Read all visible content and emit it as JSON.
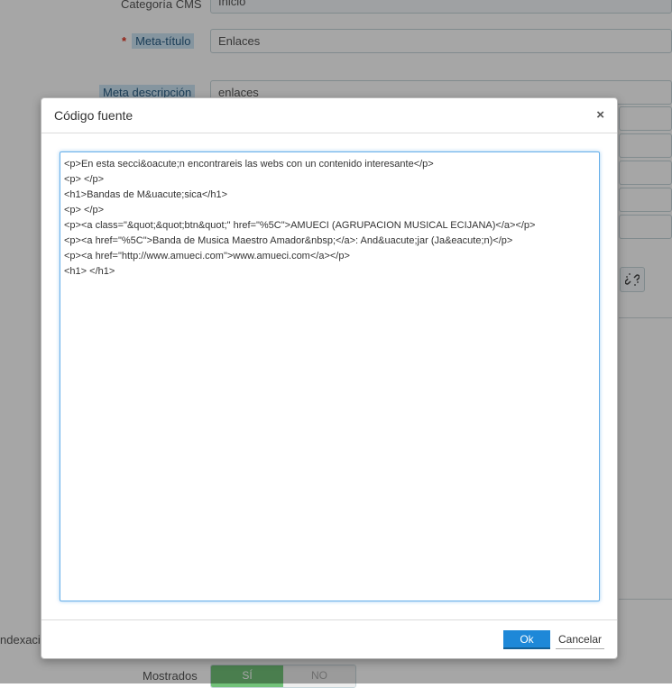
{
  "form": {
    "category_label": "Categoría CMS",
    "category_value": "Inicio",
    "meta_title_label": "Meta-título",
    "meta_title_value": "Enlaces",
    "meta_description_label": "Meta descripción",
    "meta_description_value": "enlaces",
    "indexation_label": "ndexaci",
    "shown_label": "Mostrados",
    "shown_yes": "SÍ",
    "shown_no": "NO",
    "required_mark": "*"
  },
  "modal": {
    "title": "Código fuente",
    "close_glyph": "×",
    "source_code": "<p>En esta secci&oacute;n encontrareis las webs con un contenido interesante</p>\n<p> </p>\n<h1>Bandas de M&uacute;sica</h1>\n<p> </p>\n<p><a class=\"&quot;&quot;btn&quot;\" href=\"%5C\">AMUECI (AGRUPACION MUSICAL ECIJANA)</a></p>\n<p><a href=\"%5C\">Banda de Musica Maestro Amador&nbsp;</a>: And&uacute;jar (Ja&eacute;n)</p>\n<p><a href=\"http://www.amueci.com\">www.amueci.com</a></p>\n<h1> </h1>",
    "ok_label": "Ok",
    "cancel_label": "Cancelar"
  },
  "icons": {
    "unlink": "unlink-icon",
    "close": "close-icon"
  },
  "colors": {
    "accent": "#1e88d8",
    "toggle_yes": "#72c279",
    "label_highlight": "#cde5f5"
  }
}
